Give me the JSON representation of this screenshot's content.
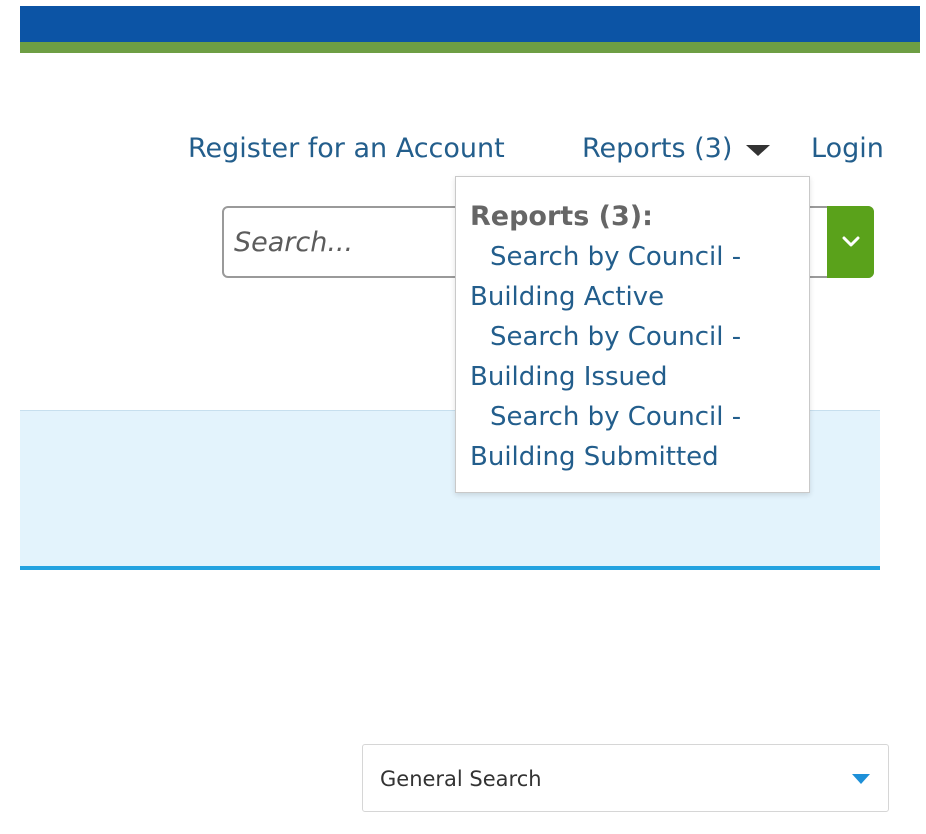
{
  "header": {
    "register_label": "Register for an Account",
    "reports_label": "Reports (3)",
    "login_label": "Login",
    "brand_blue": "#0c54a5",
    "brand_green": "#6e9e44"
  },
  "search": {
    "placeholder": "Search...",
    "toggle_icon": "chevron-down-icon",
    "toggle_color": "#5aa21b"
  },
  "reports_menu": {
    "heading": "Reports (3):",
    "items": [
      "Search by Council - Building Active",
      "Search by Council - Building Issued",
      "Search by Council - Building Submitted"
    ]
  },
  "search_type": {
    "selected": "General Search",
    "icon": "caret-down-icon"
  }
}
